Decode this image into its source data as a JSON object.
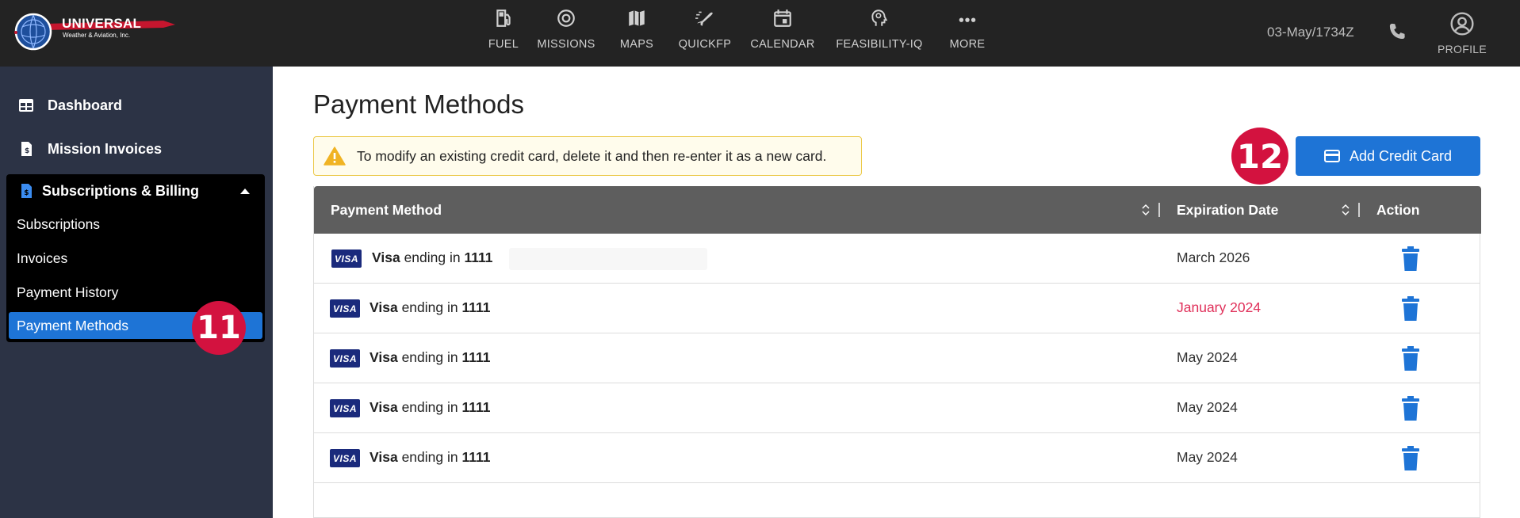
{
  "header": {
    "logo": {
      "name": "UNIVERSAL",
      "tagline": "Weather & Aviation, Inc."
    },
    "nav": [
      {
        "id": "fuel",
        "label": "FUEL",
        "icon": "fuel-pump-icon"
      },
      {
        "id": "missions",
        "label": "MISSIONS",
        "icon": "target-icon"
      },
      {
        "id": "maps",
        "label": "MAPS",
        "icon": "map-icon"
      },
      {
        "id": "quickfp",
        "label": "QUICKFP",
        "icon": "plane-takeoff-icon"
      },
      {
        "id": "calendar",
        "label": "CALENDAR",
        "icon": "calendar-icon"
      },
      {
        "id": "feasibility",
        "label": "FEASIBILITY-IQ",
        "icon": "head-thinking-icon"
      },
      {
        "id": "more",
        "label": "MORE",
        "icon": "more-dots-icon"
      }
    ],
    "datetime": "03-May/1734Z",
    "profile_label": "PROFILE"
  },
  "sidebar": {
    "dashboard": "Dashboard",
    "mission_invoices": "Mission Invoices",
    "subscriptions_billing": "Subscriptions & Billing",
    "sub_items": [
      "Subscriptions",
      "Invoices",
      "Payment History",
      "Payment Methods"
    ],
    "active_item": "Payment Methods"
  },
  "badges": {
    "sidebar": "11",
    "add_card": "12"
  },
  "main": {
    "title": "Payment Methods",
    "notice": "To modify an existing credit card, delete it and then re-enter it as a new card.",
    "add_button": "Add Credit Card",
    "table": {
      "columns": [
        "Payment Method",
        "Expiration Date",
        "Action"
      ],
      "rows": [
        {
          "brand": "Visa",
          "mid": "ending in",
          "last4": "1111",
          "expiration": "March 2026",
          "expired": false
        },
        {
          "brand": "Visa",
          "mid": "ending in",
          "last4": "1111",
          "expiration": "January 2024",
          "expired": true
        },
        {
          "brand": "Visa",
          "mid": "ending in",
          "last4": "1111",
          "expiration": "May 2024",
          "expired": false
        },
        {
          "brand": "Visa",
          "mid": "ending in",
          "last4": "1111",
          "expiration": "May 2024",
          "expired": false
        },
        {
          "brand": "Visa",
          "mid": "ending in",
          "last4": "1111",
          "expiration": "May 2024",
          "expired": false
        }
      ],
      "visa_badge": "VISA"
    }
  },
  "colors": {
    "topbar": "#232323",
    "sidebar": "#2c3345",
    "accent": "#1e74d6",
    "badge": "#d3123f",
    "expired": "#e0305a"
  }
}
